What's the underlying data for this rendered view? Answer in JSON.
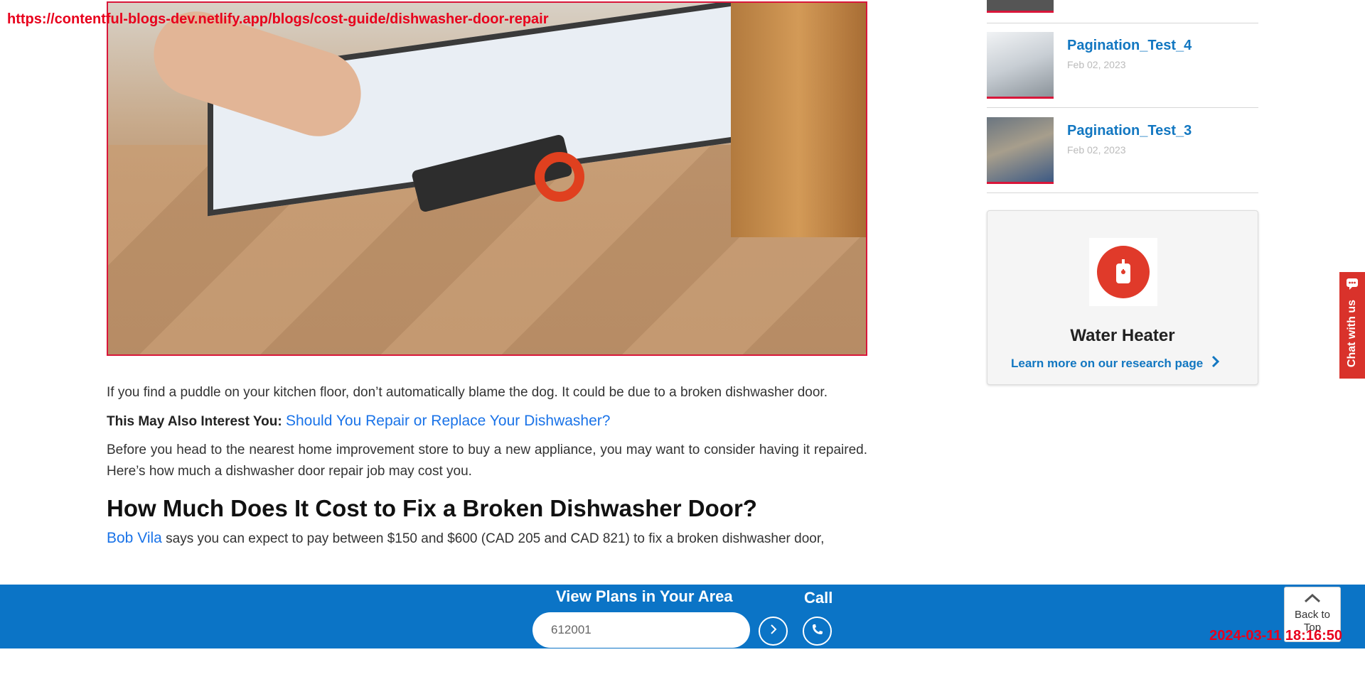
{
  "browser": {
    "url": "https://contentful-blogs-dev.netlify.app/blogs/cost-guide/dishwasher-door-repair",
    "timestamp": "2024-03-11 18:16:50"
  },
  "article": {
    "paragraph_1": "If you find a puddle on your kitchen floor, don’t automatically blame the dog. It could be due to a broken dishwasher door.",
    "also_lead": "This May Also Interest You:",
    "also_link": "Should You Repair or Replace Your Dishwasher?",
    "paragraph_2": "Before you head to the nearest home improvement store to buy a new appliance, you may want to consider having it repaired. Here’s how much a dishwasher door repair job may cost you.",
    "heading": "How Much Does It Cost to Fix a Broken Dishwasher Door?",
    "paragraph_3_link": "Bob Vila",
    "paragraph_3_text": " says you can expect to pay between $150 and $600 (CAD 205 and CAD 821) to fix a broken dishwasher door,"
  },
  "sidebar": {
    "posts": [
      {
        "title": "Pagination_Test_4",
        "date": "Feb 02, 2023"
      },
      {
        "title": "Pagination_Test_3",
        "date": "Feb 02, 2023"
      }
    ],
    "card": {
      "title": "Water Heater",
      "link": "Learn more on our research page"
    }
  },
  "chat": {
    "label": "Chat with us"
  },
  "bottom_bar": {
    "plans_label": "View Plans in Your Area",
    "zip_value": "612001",
    "call_label": "Call",
    "accent": "#0b74c6"
  },
  "back_to_top": {
    "label": "Back to Top"
  }
}
